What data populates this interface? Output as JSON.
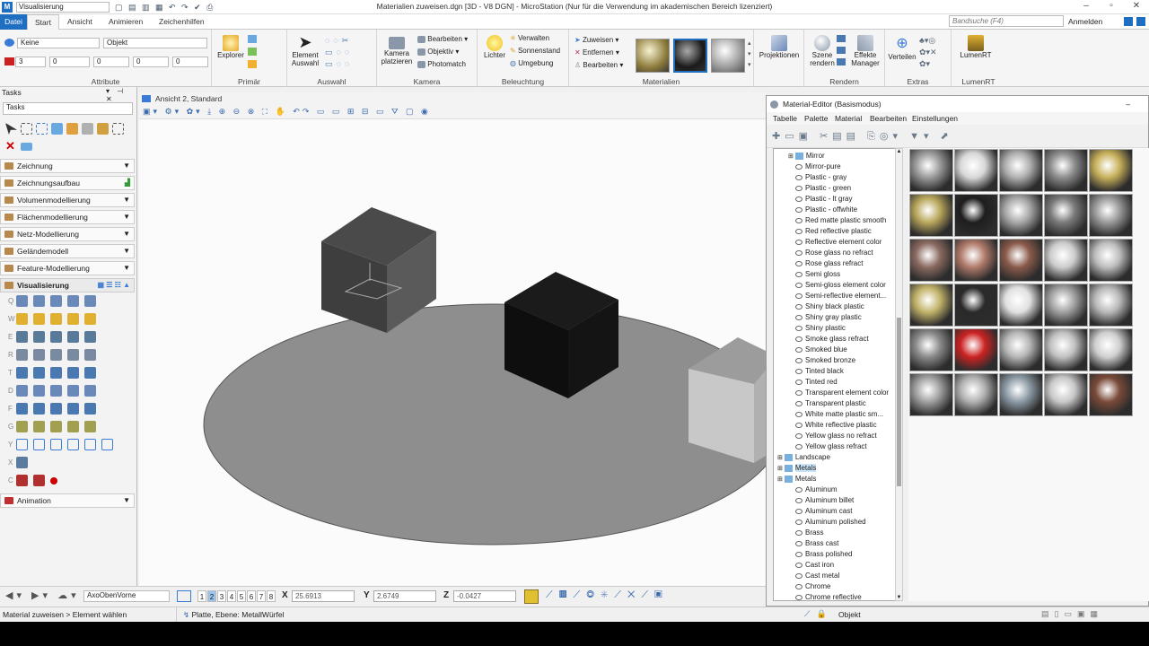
{
  "titlebar": {
    "workspace": "Visualisierung",
    "title": "Materialien zuweisen.dgn [3D - V8 DGN] - MicroStation (Nur für die Verwendung im akademischen Bereich lizenziert)"
  },
  "ribbon_tabs": [
    "Datei",
    "Start",
    "Ansicht",
    "Animieren",
    "Zeichenhilfen"
  ],
  "band_search": "Bandsuche (F4)",
  "login": "Anmelden",
  "attribute": {
    "level": "Keine",
    "element": "Objekt",
    "color": "3",
    "style": "0",
    "weight": "0",
    "trans": "0",
    "prio": "0",
    "label": "Attribute"
  },
  "groups": {
    "primar": "Primär",
    "explorer": "Explorer",
    "auswahl": "Auswahl",
    "element_auswahl": "Element\nAuswahl",
    "kamera": "Kamera",
    "kamera_platzieren": "Kamera\nplatzieren",
    "kamera_items": [
      "Bearbeiten",
      "Objektiv",
      "Photomatch"
    ],
    "beleuchtung": "Beleuchtung",
    "lichter": "Lichter",
    "bel_items": [
      "Verwalten",
      "Sonnenstand",
      "Umgebung"
    ],
    "mat_items": [
      "Zuweisen",
      "Entfernen",
      "Bearbeiten"
    ],
    "materialien": "Materialien",
    "projektionen": "Projektionen",
    "rendern": "Rendern",
    "szene_rendern": "Szene\nrendern",
    "effekte": "Effekte\nManager",
    "extras": "Extras",
    "verteilen": "Verteilen",
    "lumenrt": "LumenRT",
    "lumenrt_btn": "LumenRT"
  },
  "tasks": {
    "title": "Tasks",
    "selector": "Tasks",
    "headers": [
      "Zeichnung",
      "Zeichnungsaufbau",
      "Volumenmodellierung",
      "Flächenmodellierung",
      "Netz-Modellierung",
      "Geländemodell",
      "Feature-Modellierung",
      "Visualisierung"
    ],
    "animation": "Animation",
    "row_letters": [
      "Q",
      "W",
      "E",
      "R",
      "T",
      "D",
      "F",
      "G",
      "Y",
      "X",
      "C"
    ]
  },
  "view": {
    "title": "Ansicht 2, Standard"
  },
  "material_editor": {
    "title": "Material-Editor (Basismodus)",
    "menu": [
      "Tabelle",
      "Palette",
      "Material",
      "Bearbeiten",
      "Einstellungen"
    ],
    "tree": [
      {
        "label": "Mirror",
        "level": 1,
        "kind": "folder"
      },
      {
        "label": "Mirror-pure",
        "level": 2
      },
      {
        "label": "Plastic - gray",
        "level": 2
      },
      {
        "label": "Plastic - green",
        "level": 2
      },
      {
        "label": "Plastic - lt gray",
        "level": 2
      },
      {
        "label": "Plastic - offwhite",
        "level": 2
      },
      {
        "label": "Red matte plastic smooth",
        "level": 2
      },
      {
        "label": "Red reflective plastic",
        "level": 2
      },
      {
        "label": "Reflective element color",
        "level": 2
      },
      {
        "label": "Rose glass no refract",
        "level": 2
      },
      {
        "label": "Rose glass refract",
        "level": 2
      },
      {
        "label": "Semi gloss",
        "level": 2
      },
      {
        "label": "Semi-gloss element color",
        "level": 2
      },
      {
        "label": "Semi-reflective element...",
        "level": 2
      },
      {
        "label": "Shiny black plastic",
        "level": 2
      },
      {
        "label": "Shiny gray plastic",
        "level": 2
      },
      {
        "label": "Shiny plastic",
        "level": 2
      },
      {
        "label": "Smoke glass refract",
        "level": 2
      },
      {
        "label": "Smoked blue",
        "level": 2
      },
      {
        "label": "Smoked bronze",
        "level": 2
      },
      {
        "label": "Tinted black",
        "level": 2
      },
      {
        "label": "Tinted red",
        "level": 2
      },
      {
        "label": "Transparent element color",
        "level": 2
      },
      {
        "label": "Transparent plastic",
        "level": 2
      },
      {
        "label": "White matte plastic sm...",
        "level": 2
      },
      {
        "label": "White reflective plastic",
        "level": 2
      },
      {
        "label": "Yellow glass no refract",
        "level": 2
      },
      {
        "label": "Yellow glass refract",
        "level": 2
      },
      {
        "label": "Landscape",
        "level": 0,
        "kind": "palette"
      },
      {
        "label": "Metals",
        "level": 0,
        "kind": "palette"
      },
      {
        "label": "Metals",
        "level": 0,
        "kind": "palette"
      },
      {
        "label": "Aluminum",
        "level": 2
      },
      {
        "label": "Aluminum billet",
        "level": 2
      },
      {
        "label": "Aluminum cast",
        "level": 2
      },
      {
        "label": "Aluminum polished",
        "level": 2
      },
      {
        "label": "Brass",
        "level": 2
      },
      {
        "label": "Brass cast",
        "level": 2
      },
      {
        "label": "Brass polished",
        "level": 2
      },
      {
        "label": "Cast iron",
        "level": 2
      },
      {
        "label": "Cast metal",
        "level": 2
      },
      {
        "label": "Chrome",
        "level": 2
      },
      {
        "label": "Chrome reflective",
        "level": 2
      }
    ],
    "swatch_colors": [
      [
        "#9a9a9a",
        "#d8d8d8",
        "#b0b0b0",
        "#8c8c8c",
        "#c7b05a"
      ],
      [
        "#b9a75c",
        "#1e1e1e",
        "#a8a8a8",
        "#7a7a7a",
        "#9a9a9a"
      ],
      [
        "#8a6a60",
        "#b07a6a",
        "#8a5a4a",
        "#cccccc",
        "#bdbdbd"
      ],
      [
        "#c2b36a",
        "#2a2a2a",
        "#e0e0e0",
        "#a0a0a0",
        "#b8b8b8"
      ],
      [
        "#8a8a8a",
        "#cc2222",
        "#b5b5b5",
        "#c0c0c0",
        "#cfcfcf"
      ],
      [
        "#a0a0a0",
        "#b0b0b0",
        "#8c9aa5",
        "#c8c8c8",
        "#7a4a38"
      ]
    ]
  },
  "status": {
    "view_tool": "AxoObenVorne",
    "views": [
      "1",
      "2",
      "3",
      "4",
      "5",
      "6",
      "7",
      "8"
    ],
    "x_label": "X",
    "x": "25.6913",
    "y_label": "Y",
    "y": "2.6749",
    "z_label": "Z",
    "z": "-0.0427",
    "prompt": "Material zuweisen > Element wählen",
    "info": "Platte, Ebene: MetallWürfel",
    "object": "Objekt"
  },
  "colors": {
    "accent": "#1e6fc2"
  }
}
